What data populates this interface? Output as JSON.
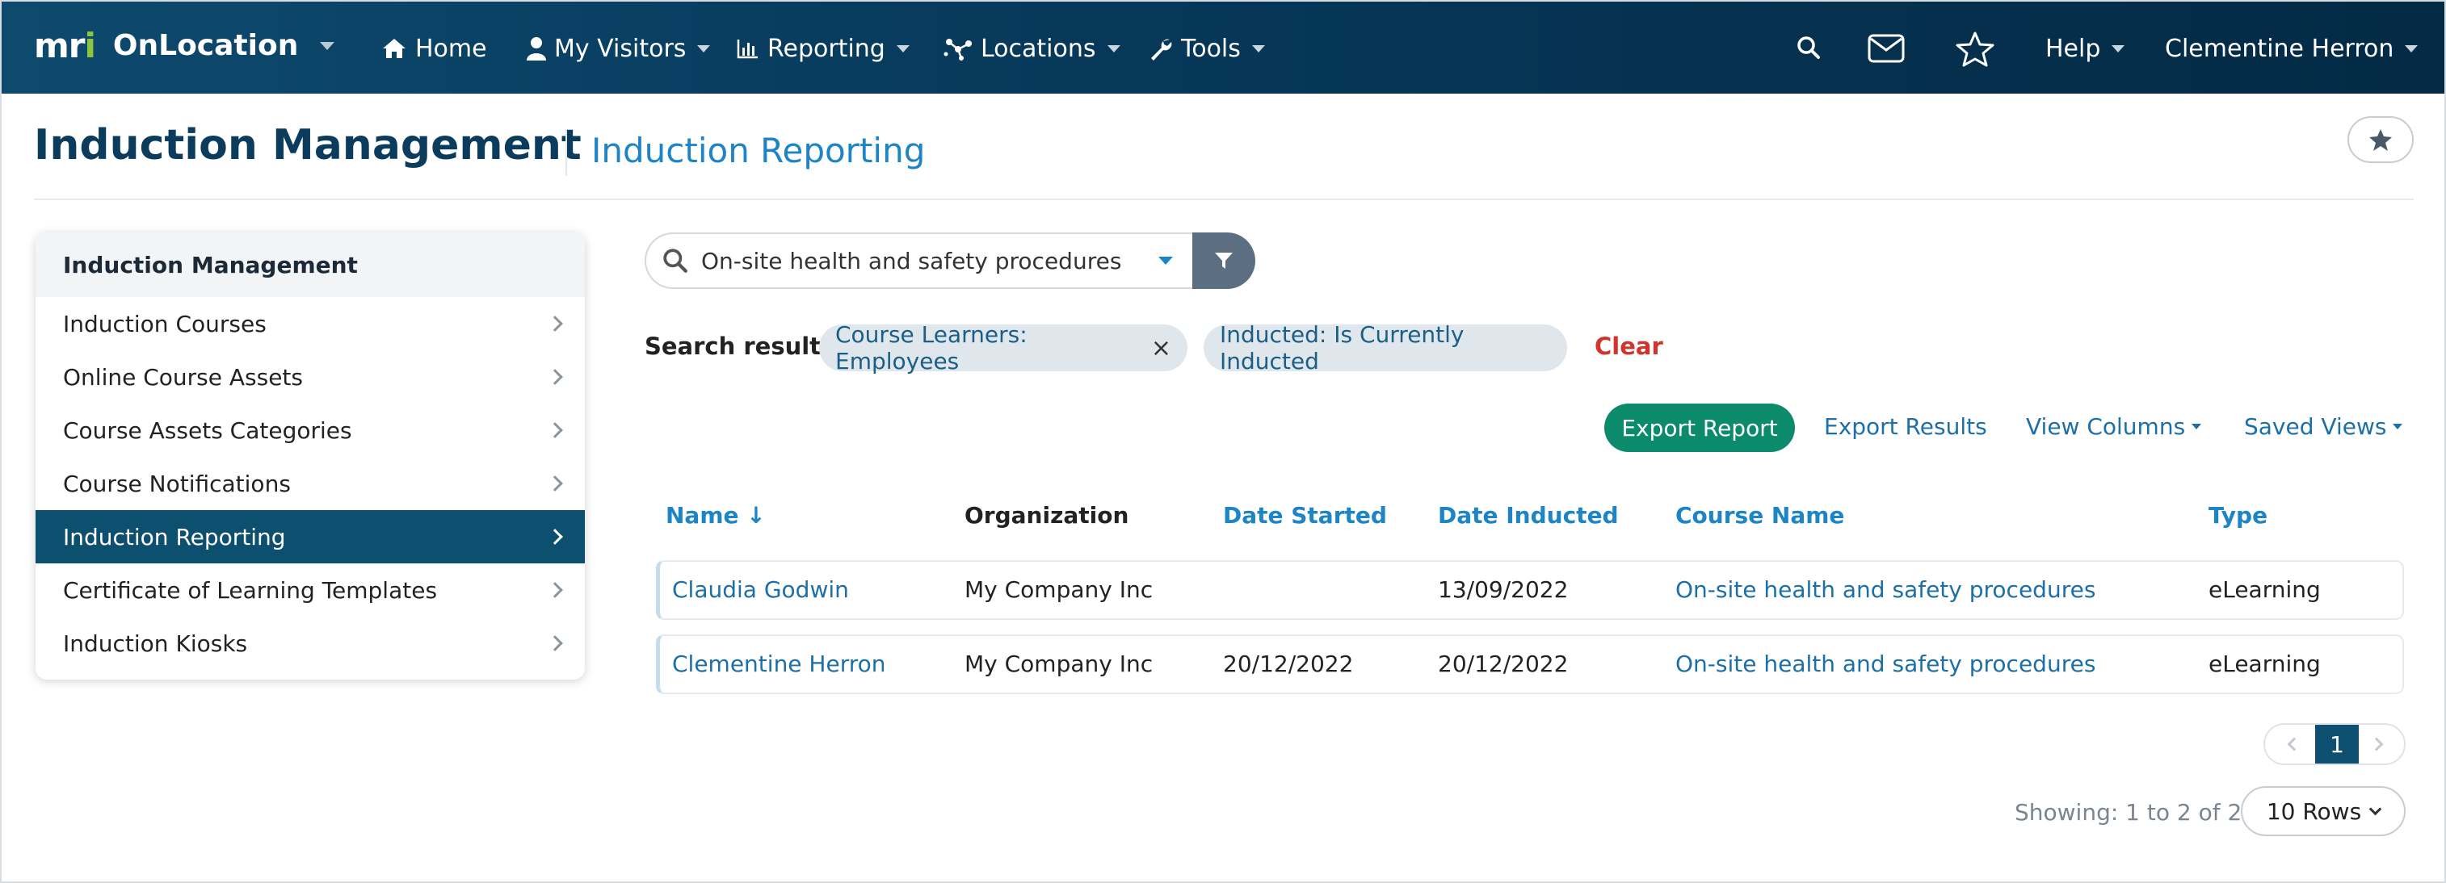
{
  "nav": {
    "brand_logo": "mri",
    "brand_name": "OnLocation",
    "items": [
      {
        "label": "Home",
        "icon": "home-icon"
      },
      {
        "label": "My Visitors",
        "icon": "user-icon"
      },
      {
        "label": "Reporting",
        "icon": "bar-chart-icon"
      },
      {
        "label": "Locations",
        "icon": "network-icon"
      },
      {
        "label": "Tools",
        "icon": "wrench-icon"
      }
    ],
    "help": "Help",
    "user": "Clementine Herron"
  },
  "header": {
    "title": "Induction Management",
    "subtitle": "Induction Reporting"
  },
  "sidebar": {
    "heading": "Induction Management",
    "items": [
      {
        "label": "Induction Courses"
      },
      {
        "label": "Online Course Assets"
      },
      {
        "label": "Course Assets Categories"
      },
      {
        "label": "Course Notifications"
      },
      {
        "label": "Induction Reporting",
        "active": true
      },
      {
        "label": "Certificate of Learning Templates"
      },
      {
        "label": "Induction Kiosks"
      }
    ]
  },
  "search": {
    "value": "On-site health and safety procedures"
  },
  "results": {
    "label": "Search results:",
    "chips": [
      "Course Learners: Employees",
      "Inducted: Is Currently Inducted"
    ],
    "clear": "Clear"
  },
  "actions": {
    "export_report": "Export Report",
    "export_results": "Export Results",
    "view_columns": "View Columns",
    "saved_views": "Saved Views"
  },
  "table": {
    "columns": [
      "Name ↓",
      "Organization",
      "Date Started",
      "Date Inducted",
      "Course Name",
      "Type"
    ],
    "rows": [
      [
        "Claudia Godwin",
        "My Company Inc",
        "",
        "13/09/2022",
        "On-site health and safety procedures",
        "eLearning"
      ],
      [
        "Clementine Herron",
        "My Company Inc",
        "20/12/2022",
        "20/12/2022",
        "On-site health and safety procedures",
        "eLearning"
      ]
    ]
  },
  "pagination": {
    "current_page": "1",
    "showing": "Showing: 1 to 2 of 2",
    "rows_per_page": "10 Rows"
  },
  "colors": {
    "nav_bg": "#07385a",
    "accent": "#1d84c6",
    "active_sidebar": "#0d4f6e",
    "export_button": "#0b8a6c",
    "clear": "#d0342c"
  }
}
